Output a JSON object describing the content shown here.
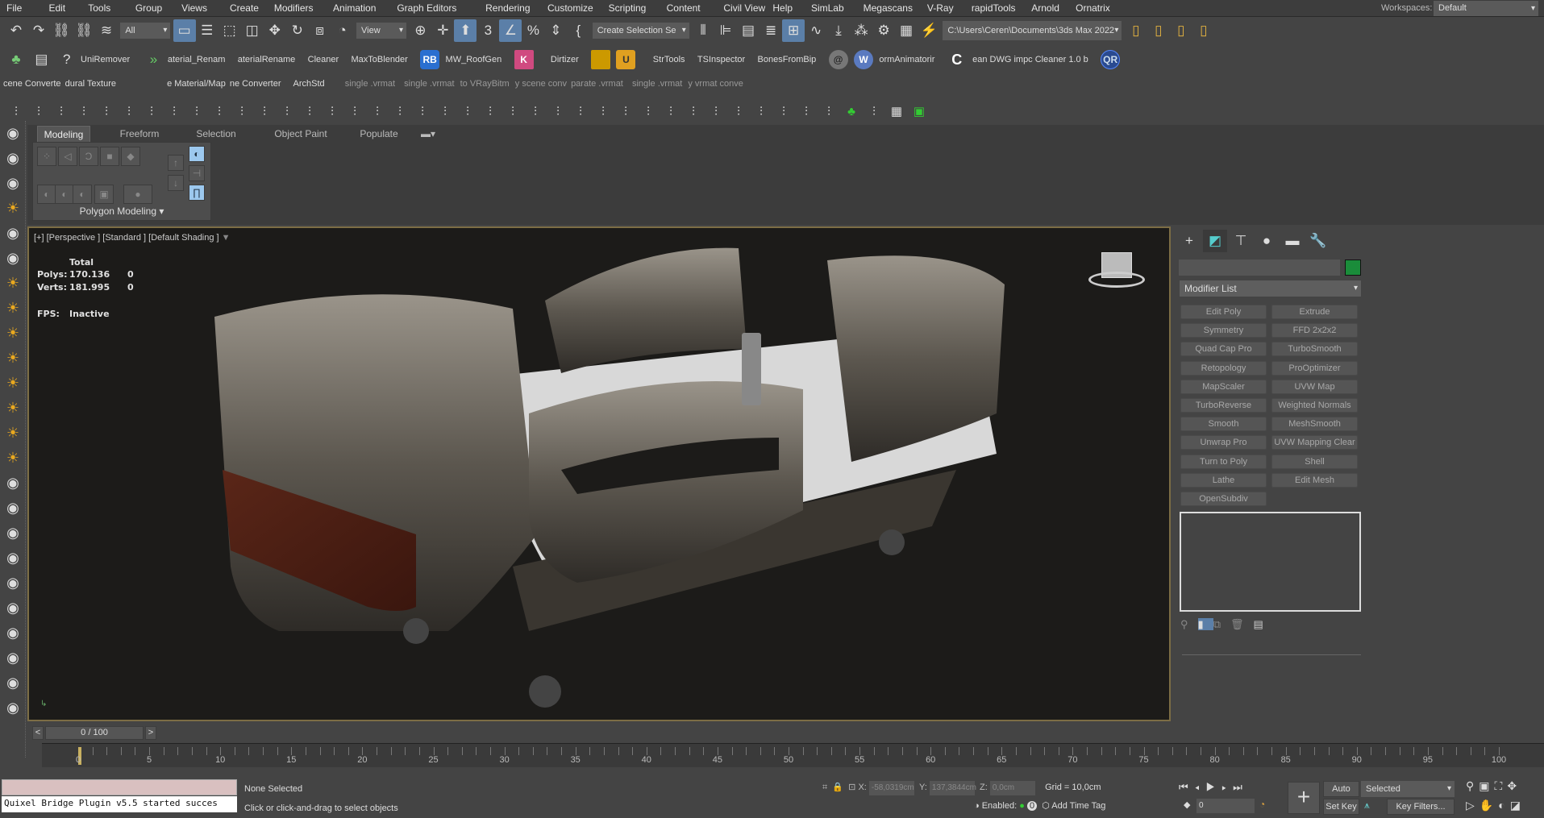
{
  "menu": [
    "File",
    "Edit",
    "Tools",
    "Group",
    "Views",
    "Create",
    "Modifiers",
    "Animation",
    "Graph Editors",
    "Rendering",
    "Customize",
    "Scripting",
    "Content",
    "Civil View",
    "Help",
    "SimLab",
    "Megascans",
    "V-Ray",
    "rapidTools",
    "Arnold",
    "Ornatrix"
  ],
  "workspaces": {
    "label": "Workspaces:",
    "value": "Default"
  },
  "toolbar": {
    "selection_filter": "All",
    "ref_coord": "View",
    "named_selection": "Create Selection Se",
    "project_path": "C:\\Users\\Ceren\\Documents\\3ds Max 2022",
    "icons_a": [
      "undo-icon",
      "redo-icon",
      "link-icon",
      "unlink-icon",
      "bind-spacewarp-icon"
    ],
    "icons_b": [
      "select-object-icon",
      "select-by-name-icon",
      "rectangle-selection-icon",
      "window-crossing-icon",
      "move-icon",
      "rotate-icon",
      "scale-icon",
      "placement-icon"
    ],
    "icons_c": [
      "pivot-icon",
      "snaps-toggle-icon",
      "manipulate-icon",
      "snap-3d-icon",
      "angle-snap-icon",
      "percent-snap-icon",
      "spinner-snap-icon",
      "edit-named-selection-icon"
    ],
    "icons_d": [
      "mirror-icon",
      "align-icon",
      "scene-explorer-icon",
      "layer-explorer-icon",
      "ribbon-toggle-icon",
      "curve-editor-icon",
      "schematic-view-icon",
      "material-editor-icon",
      "render-setup-icon",
      "rendered-frame-icon",
      "render-icon"
    ],
    "icons_e": [
      "project-folder-icon",
      "open-folder-icon",
      "hierarchy-icon",
      "asset-tracking-icon"
    ]
  },
  "plugins_row": [
    "UniRemover",
    "aterial_Renam",
    "aterialRename",
    "Cleaner",
    "MaxToBlender",
    "MW_RoofGen",
    "Dirtizer",
    "StrTools",
    "TSInspector",
    "BonesFromBip",
    "ormAnimatorir",
    "ean DWG impc Cleaner 1.0 b"
  ],
  "plugins_badges": {
    "rb": "RB",
    "qr": "QR"
  },
  "scripts_row": [
    "cene Converte",
    "dural Texture",
    "e Material/Map",
    "ne Converter",
    "ArchStd",
    "single .vrmat",
    "single .vrmat",
    "to VRayBitm",
    "y scene conv",
    "parate .vrmat",
    "single .vrmat",
    "y vrmat conve"
  ],
  "ribbon": {
    "tabs": [
      "Modeling",
      "Freeform",
      "Selection",
      "Object Paint",
      "Populate"
    ],
    "panel_label": "Polygon Modeling"
  },
  "viewport": {
    "label": "[+] [Perspective ] [Standard ] [Default Shading ]",
    "stats": {
      "header": "Total",
      "polys_label": "Polys:",
      "polys": "170.136",
      "polys_sel": "0",
      "verts_label": "Verts:",
      "verts": "181.995",
      "verts_sel": "0",
      "fps_label": "FPS:",
      "fps": "Inactive"
    }
  },
  "command_panel": {
    "modifier_list": "Modifier List",
    "object_color": "#1a8c3a",
    "modifiers": [
      "Edit Poly",
      "Extrude",
      "Symmetry",
      "FFD 2x2x2",
      "Quad Cap Pro",
      "TurboSmooth",
      "Retopology",
      "ProOptimizer",
      "MapScaler",
      "UVW Map",
      "TurboReverse",
      "Weighted Normals",
      "Smooth",
      "MeshSmooth",
      "Unwrap Pro",
      "UVW Mapping Clear",
      "Turn to Poly",
      "Shell",
      "Lathe",
      "Edit Mesh",
      "OpenSubdiv"
    ]
  },
  "timeline": {
    "slider": "0 / 100",
    "prev": "<",
    "next": ">",
    "labels": [
      "0",
      "5",
      "10",
      "15",
      "20",
      "25",
      "30",
      "35",
      "40",
      "45",
      "50",
      "55",
      "60",
      "65",
      "70",
      "75",
      "80",
      "85",
      "90",
      "95",
      "100"
    ]
  },
  "status": {
    "listener": "Quixel Bridge Plugin v5.5 started succes",
    "selection": "None Selected",
    "prompt": "Click or click-and-drag to select objects",
    "x_label": "X:",
    "x": "-58,0319cm",
    "y_label": "Y:",
    "y": "137,3844cm",
    "z_label": "Z:",
    "z": "0,0cm",
    "grid": "Grid = 10,0cm",
    "enabled": "Enabled:",
    "enabled_count": "0",
    "add_time_tag": "Add Time Tag",
    "frame": "0",
    "auto_key": "Auto Key",
    "set_key": "Set Key",
    "key_mode": "Selected",
    "key_filters": "Key Filters..."
  }
}
